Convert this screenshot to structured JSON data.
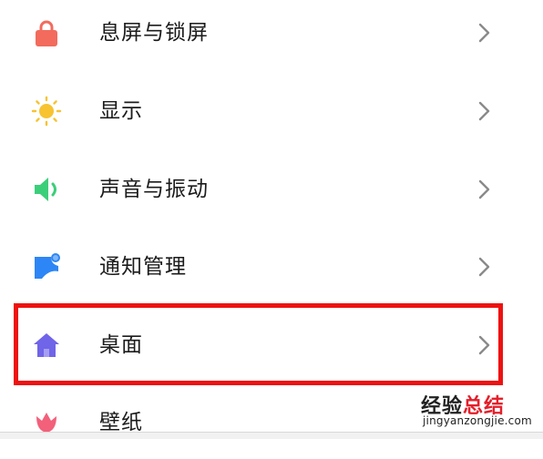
{
  "settings": {
    "items": [
      {
        "label": "息屏与锁屏",
        "icon": "lock-icon",
        "color": "#f26b5c"
      },
      {
        "label": "显示",
        "icon": "sun-icon",
        "color": "#f7c331"
      },
      {
        "label": "声音与振动",
        "icon": "speaker-icon",
        "color": "#3ccf7a"
      },
      {
        "label": "通知管理",
        "icon": "notification-icon",
        "color": "#2d86f5"
      },
      {
        "label": "桌面",
        "icon": "home-icon",
        "color": "#7064e8"
      },
      {
        "label": "壁纸",
        "icon": "flower-icon",
        "color": "#f2607a"
      }
    ],
    "highlighted_item": "桌面",
    "highlight_color": "#ee1111"
  },
  "watermark": {
    "title_part1": "经验",
    "title_part2": "总结",
    "url": "jingyanzongjie.com"
  }
}
